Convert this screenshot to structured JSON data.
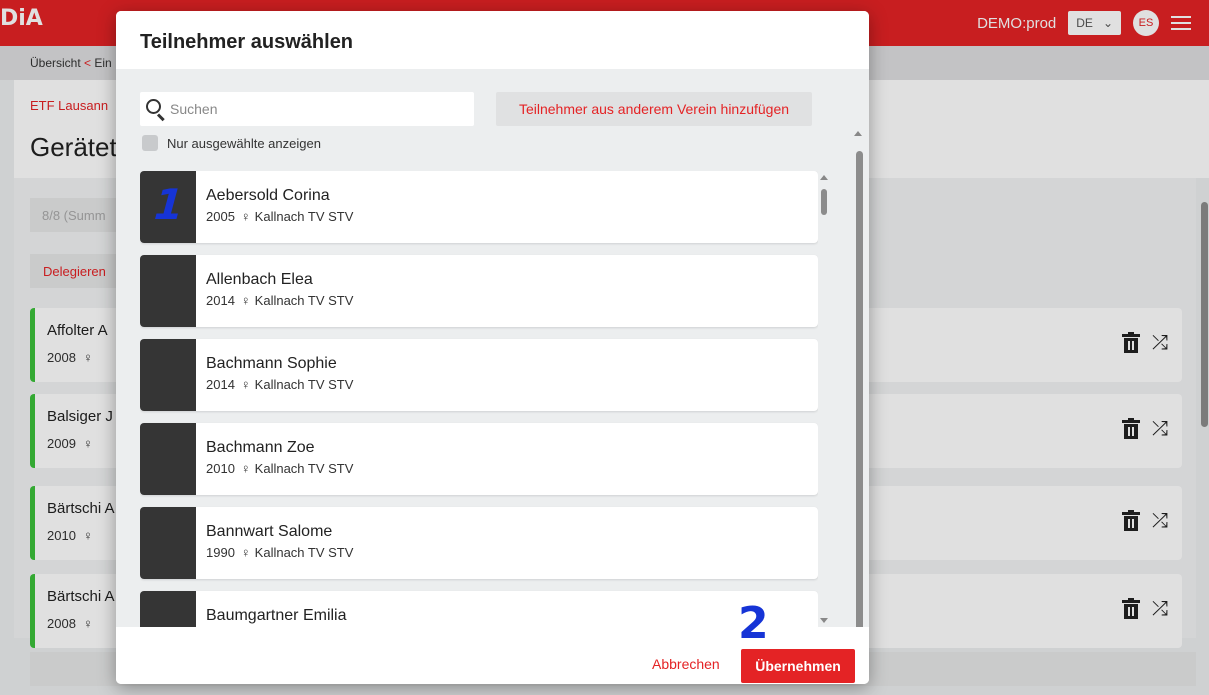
{
  "app": {
    "logo": "DiA",
    "environment": "DEMO:prod",
    "language": "DE",
    "user_initials": "ES"
  },
  "breadcrumb": {
    "first": "Übersicht",
    "separator": "<",
    "second": "Ein"
  },
  "page": {
    "club_link": "ETF Lausann",
    "title": "Gerätet",
    "filter_text": "8/8 (Summ",
    "delegate_label": "Delegieren"
  },
  "background_rows": [
    {
      "name": "Affolter A",
      "year": "2008"
    },
    {
      "name": "Balsiger J",
      "year": "2009"
    },
    {
      "name": "Bärtschi A",
      "year": "2010"
    },
    {
      "name": "Bärtschi A",
      "year": "2008"
    }
  ],
  "modal": {
    "title": "Teilnehmer auswählen",
    "search_placeholder": "Suchen",
    "add_other_label": "Teilnehmer aus anderem Verein hinzufügen",
    "only_selected_label": "Nur ausgewählte anzeigen",
    "participants": [
      {
        "name": "Aebersold Corina",
        "year": "2005",
        "gender_symbol": "♀",
        "club": "Kallnach TV STV"
      },
      {
        "name": "Allenbach Elea",
        "year": "2014",
        "gender_symbol": "♀",
        "club": "Kallnach TV STV"
      },
      {
        "name": "Bachmann Sophie",
        "year": "2014",
        "gender_symbol": "♀",
        "club": "Kallnach TV STV"
      },
      {
        "name": "Bachmann Zoe",
        "year": "2010",
        "gender_symbol": "♀",
        "club": "Kallnach TV STV"
      },
      {
        "name": "Bannwart Salome",
        "year": "1990",
        "gender_symbol": "♀",
        "club": "Kallnach TV STV"
      },
      {
        "name": "Baumgartner Emilia",
        "year": "",
        "gender_symbol": "",
        "club": ""
      }
    ],
    "cancel_label": "Abbrechen",
    "apply_label": "Übernehmen"
  },
  "annotations": {
    "first": "1",
    "second": "2",
    "color": "#1634d6"
  },
  "colors": {
    "brand": "#e42325",
    "selected_row": "#3cc13b"
  }
}
